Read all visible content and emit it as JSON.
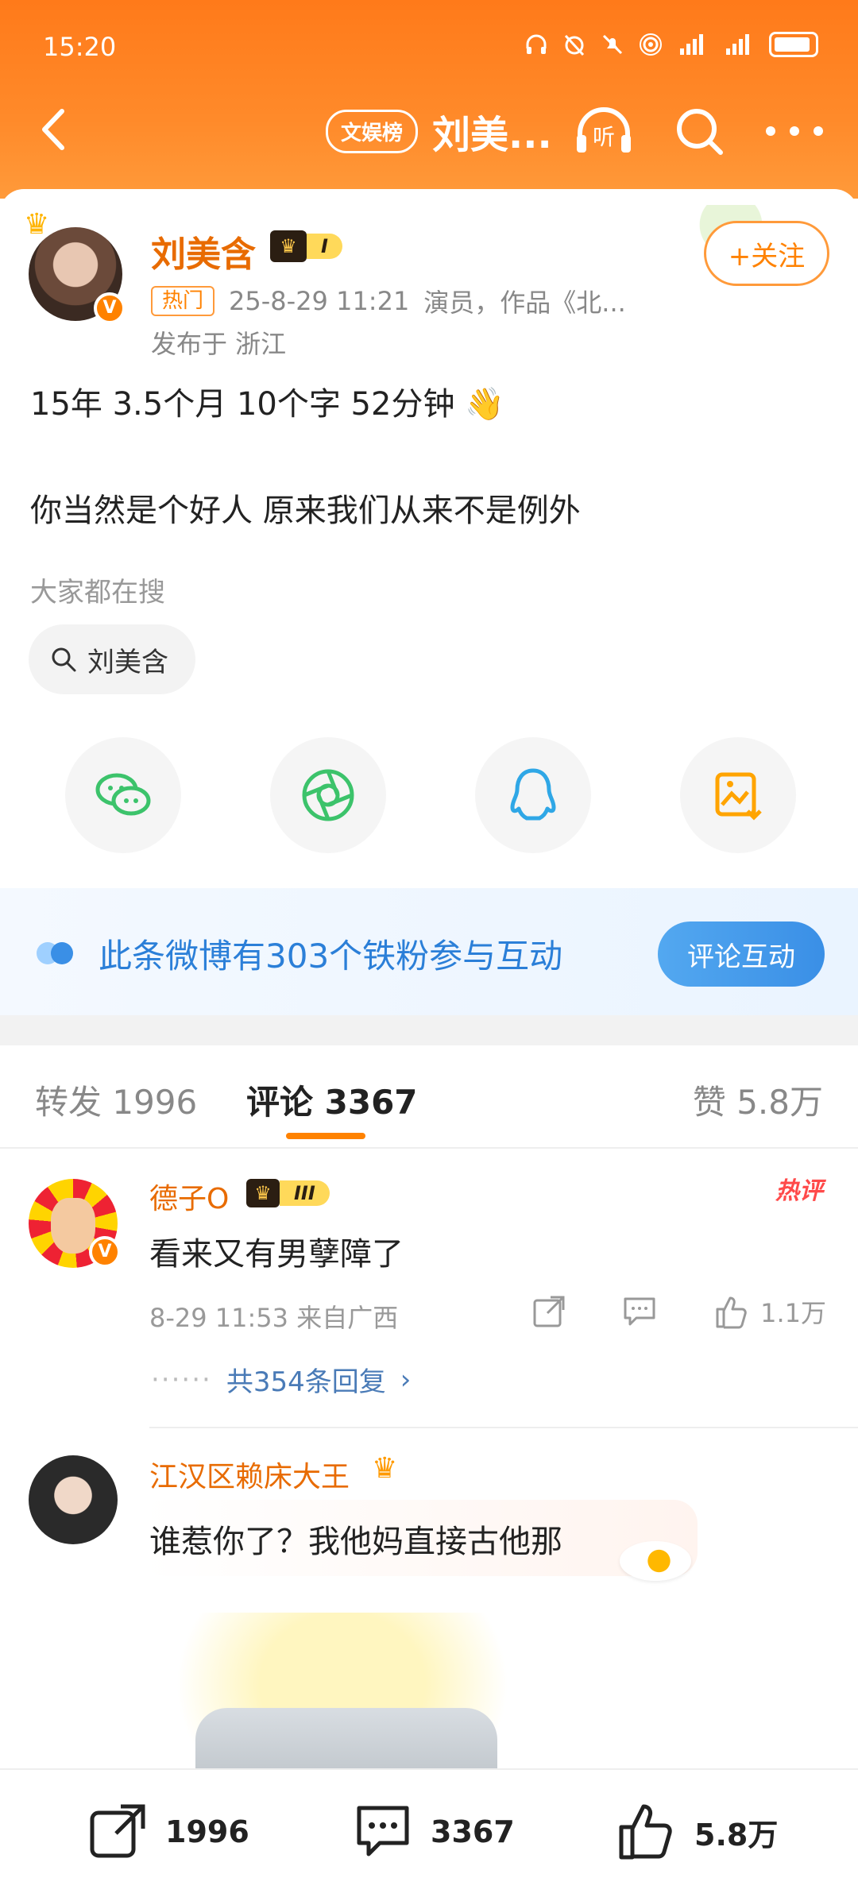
{
  "status_bar": {
    "time": "15:20"
  },
  "header": {
    "channel_badge": "文娱榜",
    "title": "刘美...",
    "listen_label": "听"
  },
  "post": {
    "author": "刘美含",
    "level": "I",
    "hot_tag": "热门",
    "timestamp": "25-8-29 11:21",
    "source": "演员，作品《北...",
    "location": "发布于 浙江",
    "follow_label": "+关注",
    "line1": "15年 3.5个月 10个字 52分钟 👋",
    "line2": "你当然是个好人   原来我们从来不是例外",
    "search_label": "大家都在搜",
    "search_chip": "刘美含"
  },
  "share_targets": [
    "wechat-icon",
    "moments-icon",
    "qq-icon",
    "save-image-icon"
  ],
  "banner": {
    "text": "此条微博有303个铁粉参与互动",
    "button": "评论互动"
  },
  "tabs": {
    "repost": "转发 1996",
    "comments": "评论 3367",
    "likes": "赞 5.8万"
  },
  "comments": [
    {
      "name": "德子O",
      "level": "III",
      "badge": "热评",
      "text": "看来又有男孽障了",
      "time": "8-29 11:53 来自广西",
      "likes": "1.1万",
      "replies": "共354条回复"
    },
    {
      "name": "江汉区赖床大王",
      "text": "谁惹你了？我他妈直接古他那"
    }
  ],
  "bottom_bar": {
    "repost": "1996",
    "comment": "3367",
    "like": "5.8万"
  },
  "colors": {
    "brand_orange": "#ff8200",
    "link_blue": "#2b7fd8"
  }
}
